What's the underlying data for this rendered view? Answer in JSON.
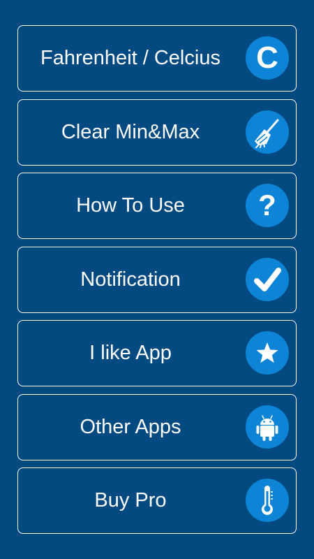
{
  "menu": {
    "items": [
      {
        "label": "Fahrenheit / Celcius",
        "icon": "celsius-c-icon"
      },
      {
        "label": "Clear Min&Max",
        "icon": "broom-icon"
      },
      {
        "label": "How To Use",
        "icon": "question-mark-icon"
      },
      {
        "label": "Notification",
        "icon": "checkmark-icon"
      },
      {
        "label": "I like App",
        "icon": "star-icon"
      },
      {
        "label": "Other Apps",
        "icon": "android-icon"
      },
      {
        "label": "Buy Pro",
        "icon": "thermometer-icon"
      }
    ]
  },
  "colors": {
    "background": "#034a80",
    "icon_circle": "#0d84d6",
    "text": "#ffffff",
    "border": "#ffffff"
  }
}
